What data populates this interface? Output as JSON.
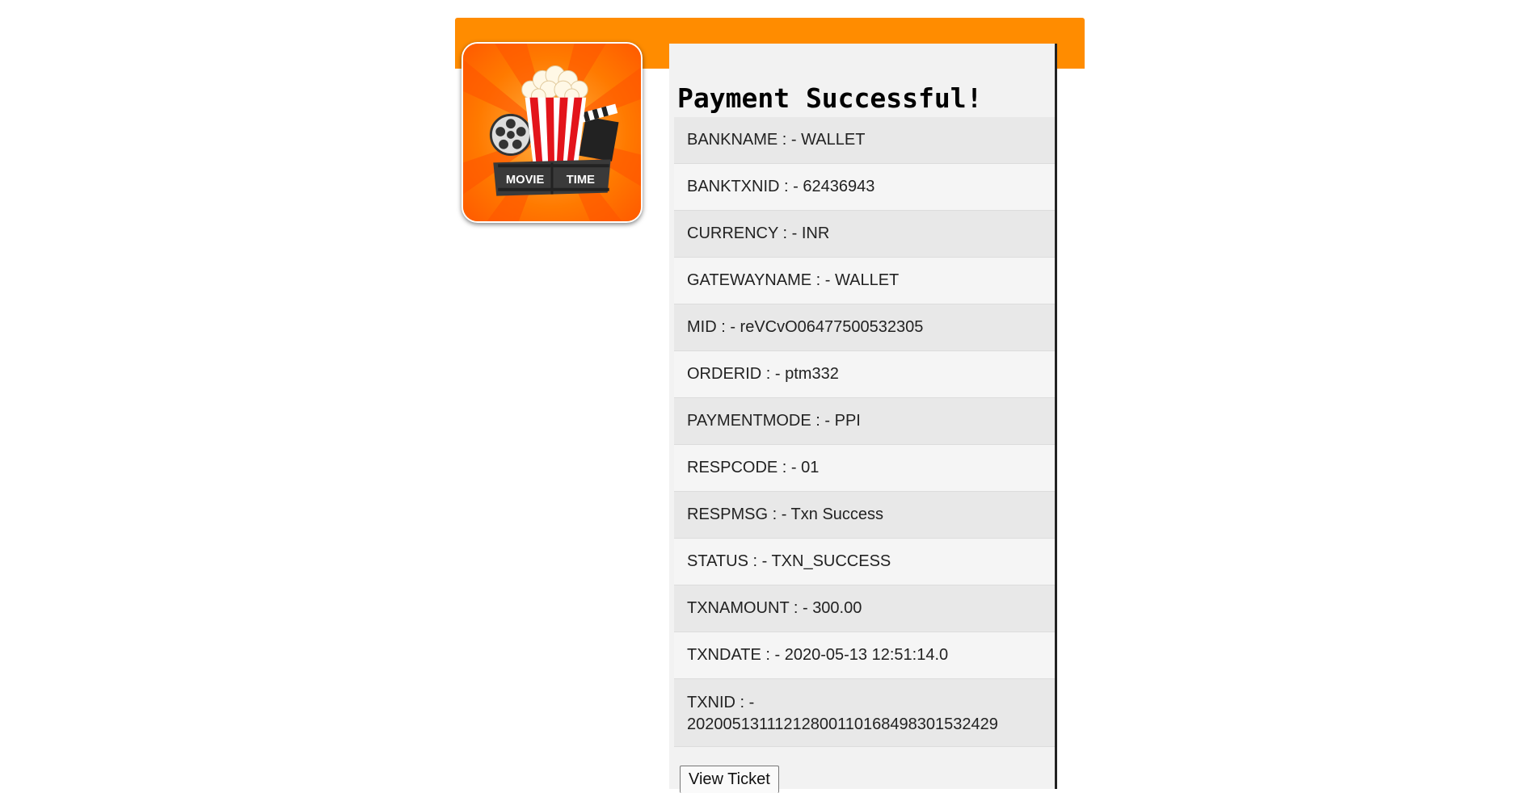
{
  "logo": {
    "line1": "MOVIE",
    "line2": "TIME"
  },
  "page": {
    "title": "Payment Successful!"
  },
  "rows": [
    {
      "key": "BANKNAME : - ",
      "value": "WALLET"
    },
    {
      "key": "BANKTXNID : - ",
      "value": "62436943"
    },
    {
      "key": "CURRENCY : - ",
      "value": "INR"
    },
    {
      "key": "GATEWAYNAME : - ",
      "value": "WALLET"
    },
    {
      "key": "MID : - ",
      "value": "reVCvO06477500532305"
    },
    {
      "key": "ORDERID : - ",
      "value": "ptm332"
    },
    {
      "key": "PAYMENTMODE : - ",
      "value": "PPI"
    },
    {
      "key": "RESPCODE : - ",
      "value": "01"
    },
    {
      "key": "RESPMSG : - ",
      "value": "Txn Success"
    },
    {
      "key": "STATUS : - ",
      "value": "TXN_SUCCESS"
    },
    {
      "key": "TXNAMOUNT : - ",
      "value": "300.00"
    },
    {
      "key": "TXNDATE : - ",
      "value": "2020-05-13 12:51:14.0"
    },
    {
      "key": "TXNID : -",
      "value": "20200513111212800110168498301532429"
    }
  ],
  "actions": {
    "view_ticket_label": "View Ticket"
  },
  "colors": {
    "header": "#ff8c00",
    "logo_bg": "#ff6a00",
    "popcorn_stripe": "#e3141b"
  }
}
